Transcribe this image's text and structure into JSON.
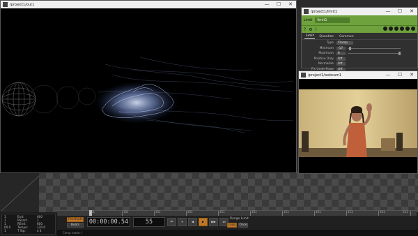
{
  "main_window": {
    "title": "/project1/out1"
  },
  "param_window": {
    "title": "/project1/limit1",
    "op_type": "Limit",
    "op_name": "limit1",
    "tabs": [
      "Limit",
      "Quantize",
      "Common"
    ],
    "active_tab": "Limit",
    "params": [
      {
        "label": "Type",
        "value": "Clamp"
      },
      {
        "label": "Minimum",
        "value": "-17"
      },
      {
        "label": "Maximum",
        "value": "6"
      },
      {
        "label": "Positive Only",
        "value": "Off"
      },
      {
        "label": "Normalize",
        "value": "Off"
      },
      {
        "label": "Fix Underflows",
        "value": "Off"
      }
    ]
  },
  "cam_window": {
    "title": "/project1/webcam1"
  },
  "stats": {
    "rows": [
      [
        "1",
        "End:",
        "600"
      ],
      [
        "1",
        "RStart:",
        "1"
      ],
      [
        "1",
        "REnd:",
        "600"
      ],
      [
        "60.0",
        "Tempo:",
        "120.0"
      ],
      [
        "1",
        "T Sig:",
        "4  4"
      ]
    ],
    "left_labels": [
      "Start:",
      "RStart:",
      "REnd:",
      "FPS:",
      "Fix:"
    ]
  },
  "timeline": {
    "tick_labels": [
      "51",
      "101",
      "151",
      "201",
      "251",
      "301",
      "351",
      "401",
      "451",
      "501",
      "551"
    ],
    "timecode": "00:00:00.54",
    "frame": "55",
    "timecode_btn": "TimeCode",
    "beats_btn": "Beats",
    "range_limit_label": "Range Limit",
    "loop_btn": "Loop",
    "once_btn": "Once",
    "transport": [
      "⏮",
      "⏸",
      "◀",
      "▶",
      "▶▶",
      "⏭"
    ],
    "status_text": "Comp made: /"
  },
  "window_buttons": {
    "minimize": "—",
    "maximize": "☐",
    "close": "✕"
  }
}
